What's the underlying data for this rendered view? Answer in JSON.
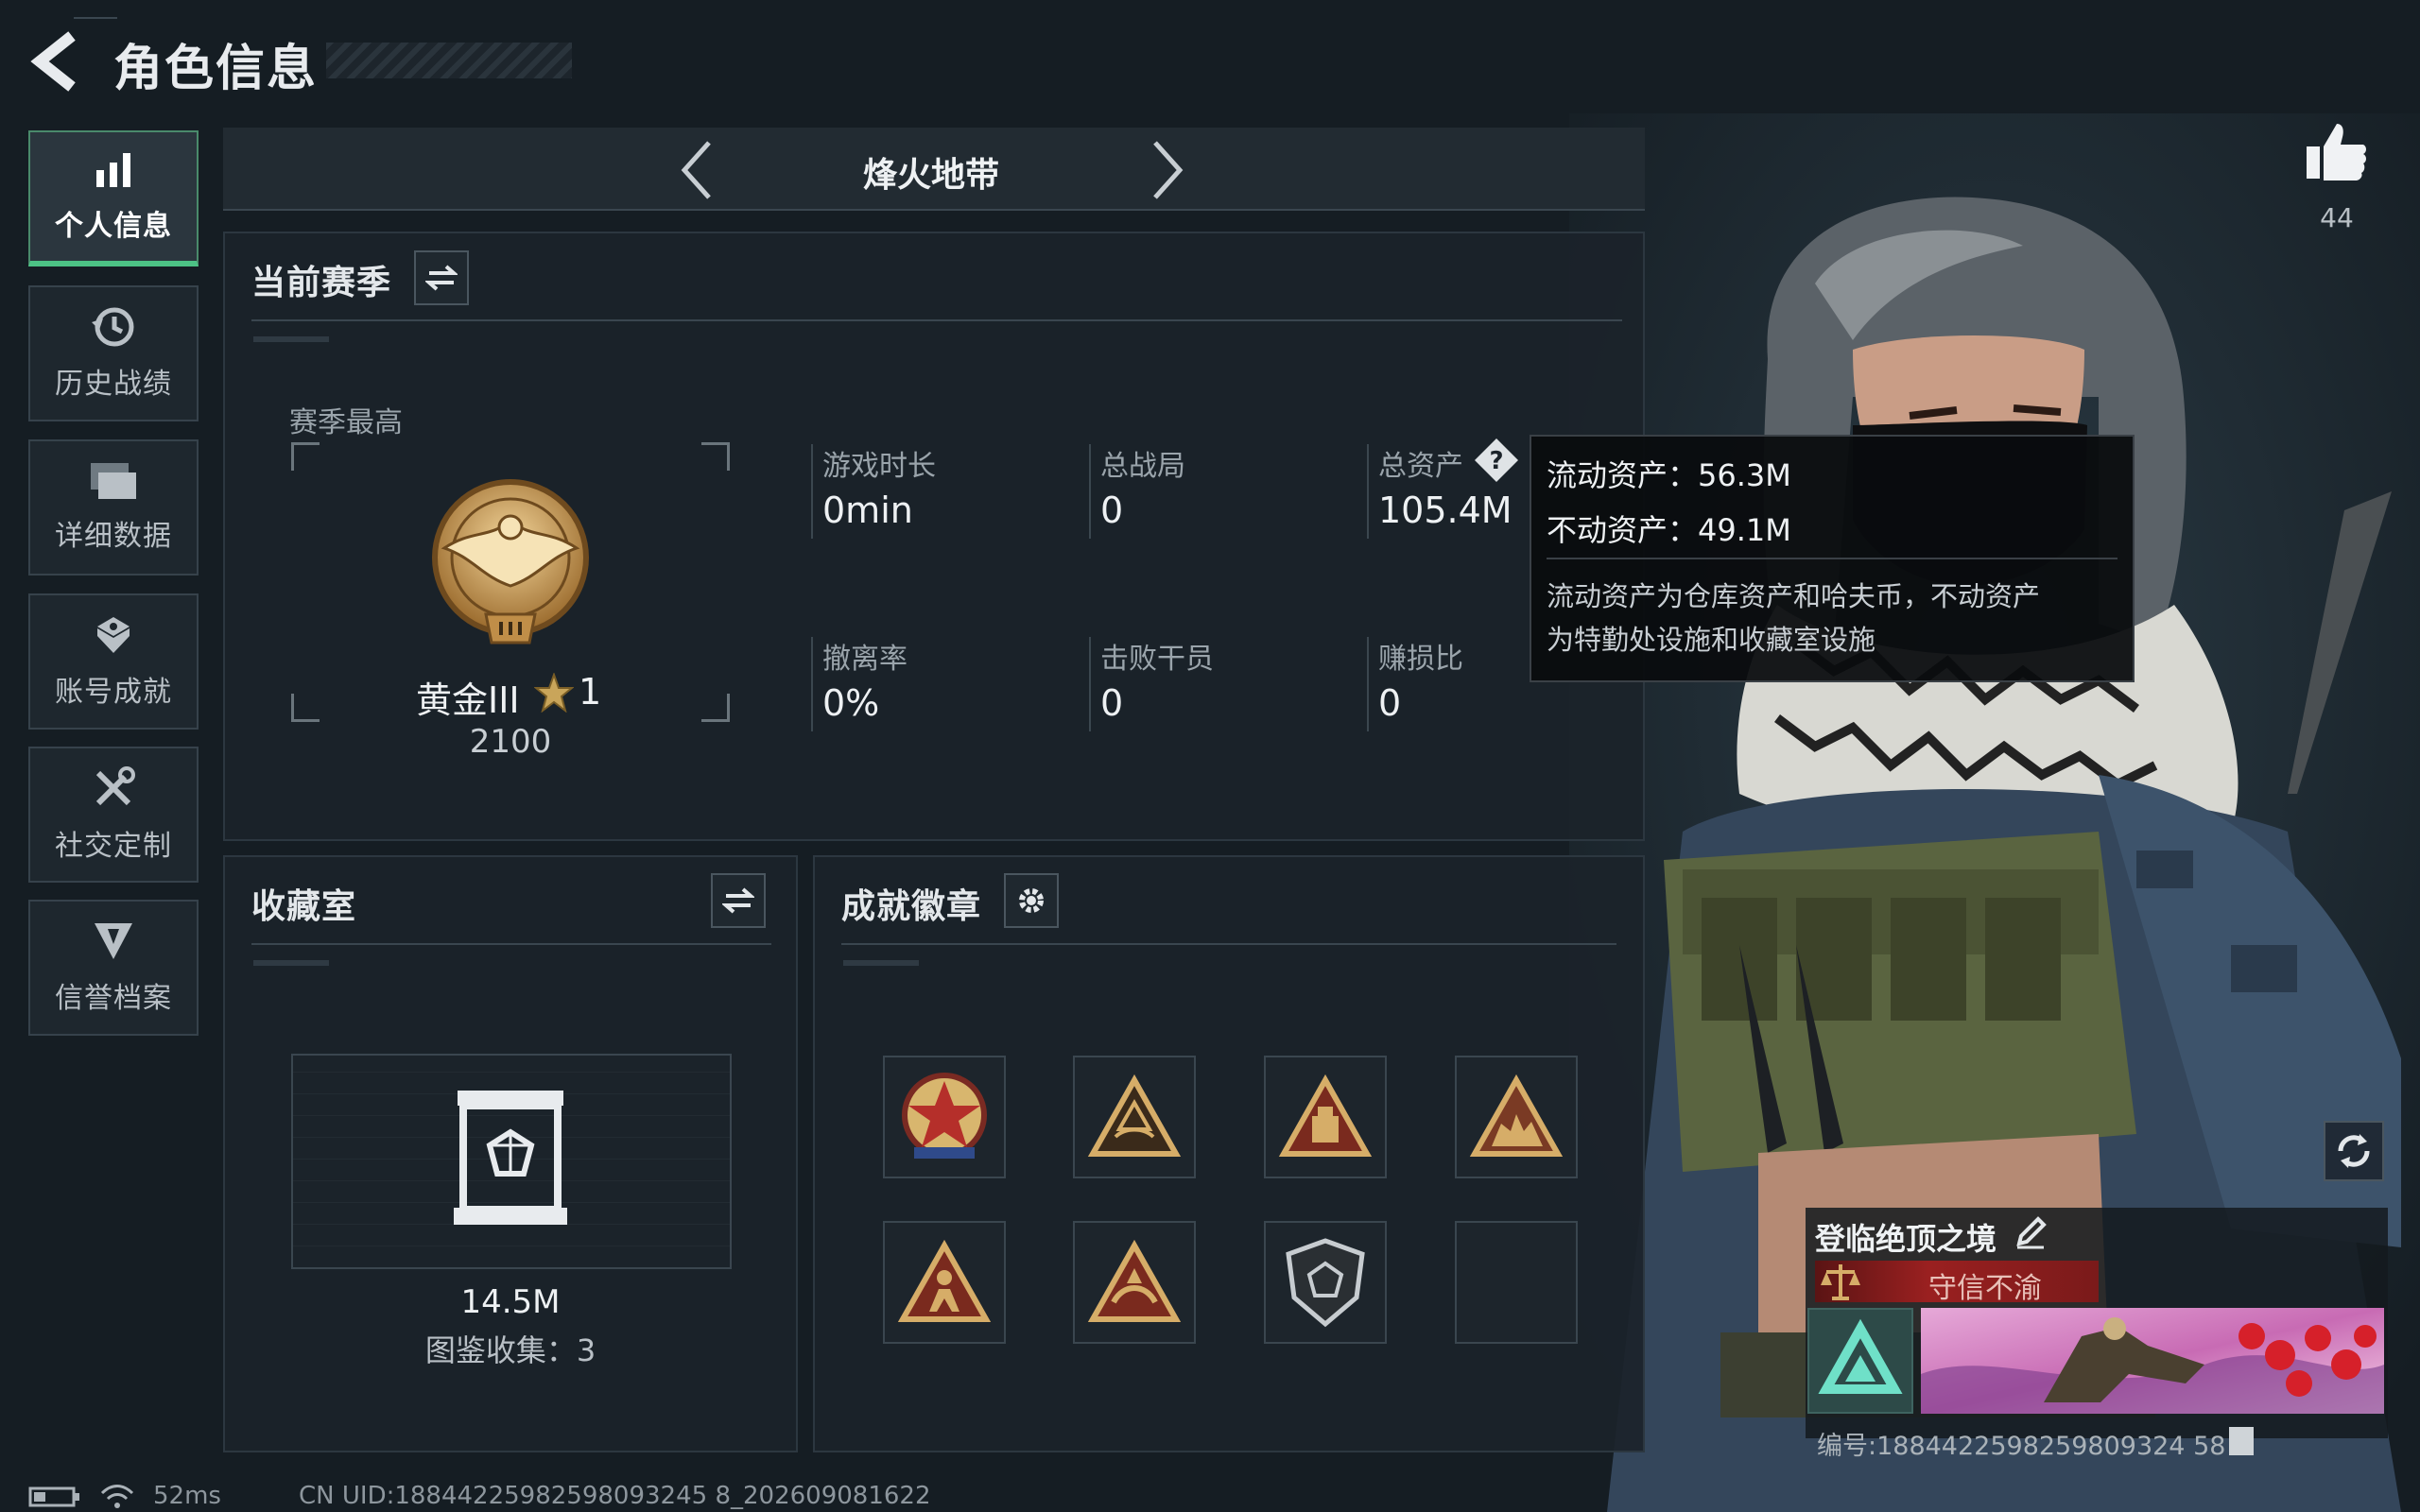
{
  "header": {
    "back_icon": "chevron-left-icon",
    "title": "角色信息"
  },
  "sidebar": {
    "items": [
      {
        "label": "个人信息",
        "icon": "bar-chart-icon",
        "active": true
      },
      {
        "label": "历史战绩",
        "icon": "history-clock-icon",
        "active": false
      },
      {
        "label": "详细数据",
        "icon": "folders-icon",
        "active": false
      },
      {
        "label": "账号成就",
        "icon": "medal-icon",
        "active": false
      },
      {
        "label": "社交定制",
        "icon": "tools-icon",
        "active": false
      },
      {
        "label": "信誉档案",
        "icon": "shield-badge-icon",
        "active": false
      }
    ]
  },
  "mode_selector": {
    "label": "烽火地带"
  },
  "season": {
    "title": "当前赛季",
    "best_label": "赛季最高",
    "rank_name": "黄金III",
    "rank_stars": "1",
    "rank_score": "2100",
    "stats": [
      {
        "label": "游戏时长",
        "value": "0min"
      },
      {
        "label": "总战局",
        "value": "0"
      },
      {
        "label": "总资产",
        "value": "105.4M"
      },
      {
        "label": "撤离率",
        "value": "0%"
      },
      {
        "label": "击败干员",
        "value": "0"
      },
      {
        "label": "赚损比",
        "value": "0"
      }
    ]
  },
  "tooltip": {
    "liquid": "流动资产：56.3M",
    "fixed": "不动资产：49.1M",
    "desc_line1": "流动资产为仓库资产和哈夫币，不动资产",
    "desc_line2": "为特勤处设施和收藏室设施"
  },
  "collection": {
    "title": "收藏室",
    "value": "14.5M",
    "count_label": "图鉴收集：3"
  },
  "achievements": {
    "title": "成就徽章",
    "badges": [
      "star-emblem-icon",
      "triangle-badge-icon",
      "triangle-crate-icon",
      "triangle-soldiers-icon",
      "triangle-figure-icon",
      "triangle-wave-icon",
      "shield-gem-icon",
      ""
    ]
  },
  "likes": {
    "icon": "thumbs-up-icon",
    "count": "44"
  },
  "profile_card": {
    "title": "登临绝顶之境",
    "tag": "守信不渝",
    "id_text": "编号:1884422598259809324 58"
  },
  "status_bar": {
    "ping": "52ms",
    "uid": "CN UID:18844225982598093245 8_202609081622"
  },
  "colors": {
    "accent_green": "#4cc285",
    "background": "#151d23",
    "panel": "#1b232a",
    "tag_red": "#8c1d1d"
  }
}
